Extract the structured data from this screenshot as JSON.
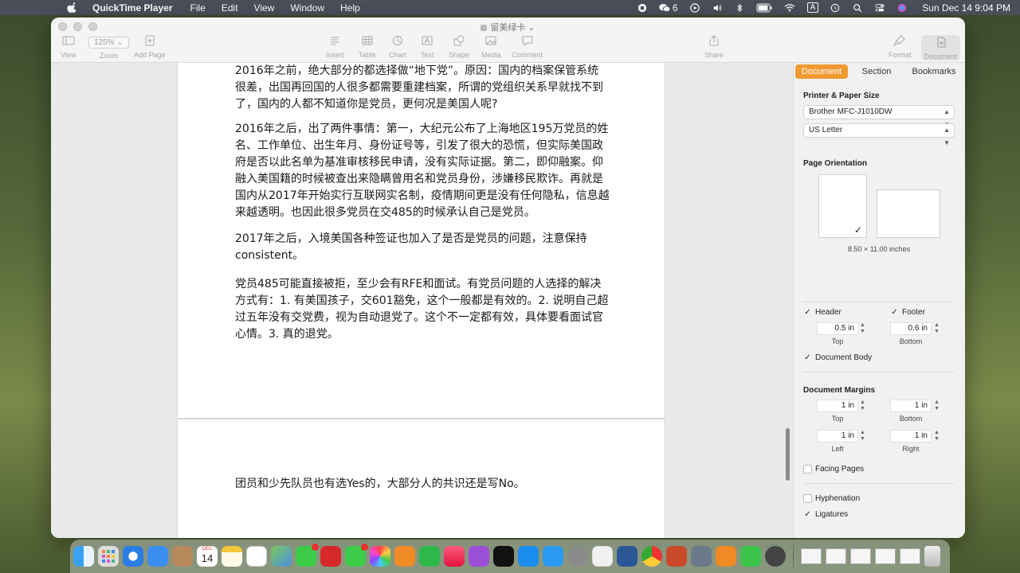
{
  "menubar": {
    "app_name": "QuickTime Player",
    "items": [
      "File",
      "Edit",
      "View",
      "Window",
      "Help"
    ],
    "wechat_count": "6",
    "input_source": "A",
    "clock": "Sun Dec 14  9:04 PM"
  },
  "window": {
    "doc_title": "留美绿卡",
    "toolbar": {
      "view": "View",
      "zoom_value": "125%",
      "zoom": "Zoom",
      "add_page": "Add Page",
      "insert": "Insert",
      "table": "Table",
      "chart": "Chart",
      "text": "Text",
      "shape": "Shape",
      "media": "Media",
      "comment": "Comment",
      "share": "Share",
      "format": "Format",
      "document": "Document"
    }
  },
  "document": {
    "paragraphs": [
      "2016年之前，绝大部分的都选择做“地下党”。原因：国内的档案保管系统很差，出国再回国的人很多都需要重建档案，所谓的党组织关系早就找不到了，国内的人都不知道你是党员，更何况是美国人呢?",
      "2016年之后，出了两件事情：第一，大纪元公布了上海地区195万党员的姓名、工作单位、出生年月、身份证号等，引发了很大的恐慌，但实际美国政府是否以此名单为基准审核移民申请，没有实际证据。第二，即仰融案。仰融入美国籍的时候被查出来隐瞒曾用名和党员身份，涉嫌移民欺诈。再就是国内从2017年开始实行互联网实名制，疫情期间更是没有任何隐私，信息越来越透明。也因此很多党员在交485的时候承认自己是党员。",
      "2017年之后，入境美国各种签证也加入了是否是党员的问题，注意保持consistent。",
      "党员485可能直接被拒，至少会有RFE和面试。有党员问题的人选择的解决方式有：1. 有美国孩子，交601豁免，这个一般都是有效的。2. 说明自己超过五年没有交党费，视为自动退党了。这个不一定都有效，具体要看面试官心情。3. 真的退党。"
    ],
    "page2_text": "团员和少先队员也有选Yes的，大部分人的共识还是写No。"
  },
  "sidebar": {
    "tabs": [
      "Document",
      "Section",
      "Bookmarks"
    ],
    "printer_label": "Printer & Paper Size",
    "printer": "Brother MFC-J1010DW",
    "paper": "US Letter",
    "orientation_label": "Page Orientation",
    "page_size": "8.50 × 11.00 inches",
    "header_label": "Header",
    "footer_label": "Footer",
    "header_value": "0.5 in",
    "footer_value": "0.6 in",
    "top": "Top",
    "bottom": "Bottom",
    "document_body": "Document Body",
    "margins_label": "Document Margins",
    "margin_top": "1 in",
    "margin_bottom": "1 in",
    "margin_left": "1 in",
    "margin_right": "1 in",
    "left": "Left",
    "right": "Right",
    "facing_pages": "Facing Pages",
    "hyphenation": "Hyphenation",
    "ligatures": "Ligatures"
  },
  "dock": {
    "calendar_day": "14",
    "calendar_month": "DEC"
  }
}
